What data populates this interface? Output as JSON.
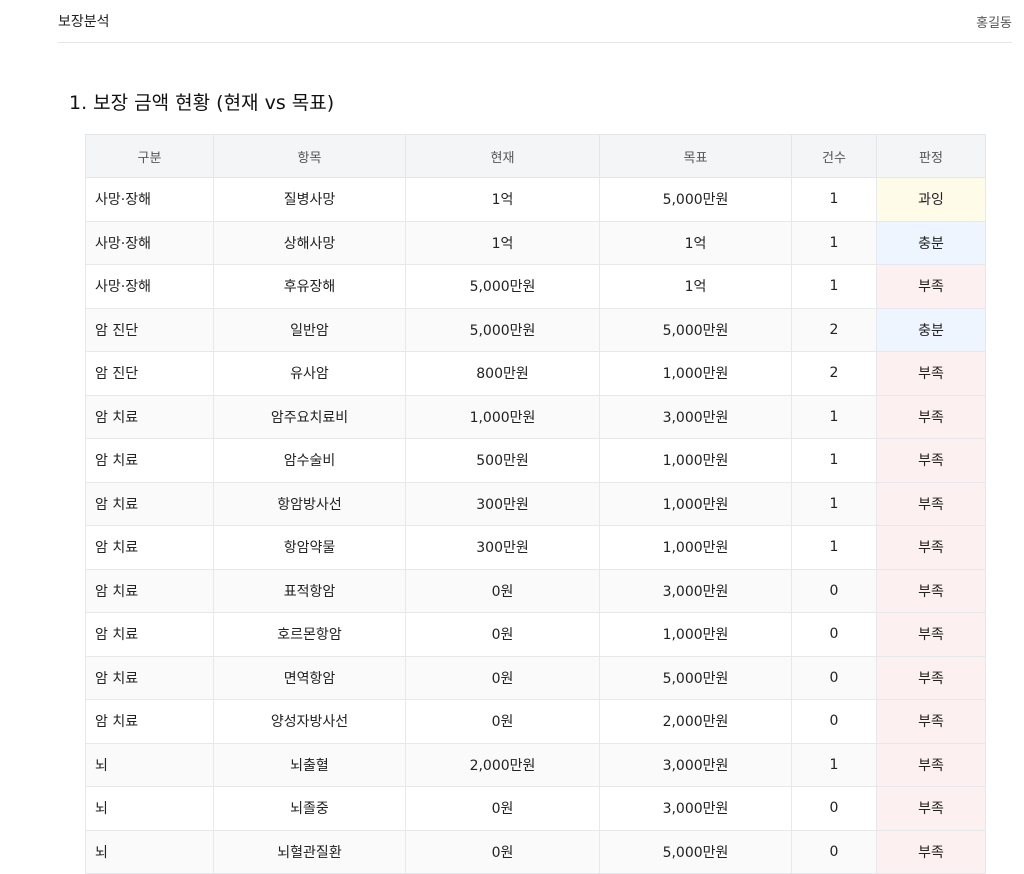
{
  "header": {
    "brand": "보장분석",
    "user": "홍길동"
  },
  "section": {
    "title": "1. 보장 금액 현황 (현재 vs 목표)"
  },
  "table": {
    "columns": [
      "구분",
      "항목",
      "현재",
      "목표",
      "건수",
      "판정"
    ],
    "rows": [
      {
        "category": "사망·장해",
        "item": "질병사망",
        "current": "1억",
        "target": "5,000만원",
        "count": "1",
        "verdict": "과잉",
        "verdict_type": "over"
      },
      {
        "category": "사망·장해",
        "item": "상해사망",
        "current": "1억",
        "target": "1억",
        "count": "1",
        "verdict": "충분",
        "verdict_type": "ok"
      },
      {
        "category": "사망·장해",
        "item": "후유장해",
        "current": "5,000만원",
        "target": "1억",
        "count": "1",
        "verdict": "부족",
        "verdict_type": "short"
      },
      {
        "category": "암 진단",
        "item": "일반암",
        "current": "5,000만원",
        "target": "5,000만원",
        "count": "2",
        "verdict": "충분",
        "verdict_type": "ok"
      },
      {
        "category": "암 진단",
        "item": "유사암",
        "current": "800만원",
        "target": "1,000만원",
        "count": "2",
        "verdict": "부족",
        "verdict_type": "short"
      },
      {
        "category": "암 치료",
        "item": "암주요치료비",
        "current": "1,000만원",
        "target": "3,000만원",
        "count": "1",
        "verdict": "부족",
        "verdict_type": "short"
      },
      {
        "category": "암 치료",
        "item": "암수술비",
        "current": "500만원",
        "target": "1,000만원",
        "count": "1",
        "verdict": "부족",
        "verdict_type": "short"
      },
      {
        "category": "암 치료",
        "item": "항암방사선",
        "current": "300만원",
        "target": "1,000만원",
        "count": "1",
        "verdict": "부족",
        "verdict_type": "short"
      },
      {
        "category": "암 치료",
        "item": "항암약물",
        "current": "300만원",
        "target": "1,000만원",
        "count": "1",
        "verdict": "부족",
        "verdict_type": "short"
      },
      {
        "category": "암 치료",
        "item": "표적항암",
        "current": "0원",
        "target": "3,000만원",
        "count": "0",
        "verdict": "부족",
        "verdict_type": "short"
      },
      {
        "category": "암 치료",
        "item": "호르몬항암",
        "current": "0원",
        "target": "1,000만원",
        "count": "0",
        "verdict": "부족",
        "verdict_type": "short"
      },
      {
        "category": "암 치료",
        "item": "면역항암",
        "current": "0원",
        "target": "5,000만원",
        "count": "0",
        "verdict": "부족",
        "verdict_type": "short"
      },
      {
        "category": "암 치료",
        "item": "양성자방사선",
        "current": "0원",
        "target": "2,000만원",
        "count": "0",
        "verdict": "부족",
        "verdict_type": "short"
      },
      {
        "category": "뇌",
        "item": "뇌출혈",
        "current": "2,000만원",
        "target": "3,000만원",
        "count": "1",
        "verdict": "부족",
        "verdict_type": "short"
      },
      {
        "category": "뇌",
        "item": "뇌졸중",
        "current": "0원",
        "target": "3,000만원",
        "count": "0",
        "verdict": "부족",
        "verdict_type": "short"
      },
      {
        "category": "뇌",
        "item": "뇌혈관질환",
        "current": "0원",
        "target": "5,000만원",
        "count": "0",
        "verdict": "부족",
        "verdict_type": "short"
      }
    ]
  },
  "colors": {
    "over": "#fefbe8",
    "ok": "#eef5ff",
    "short": "#fdf0f0"
  }
}
